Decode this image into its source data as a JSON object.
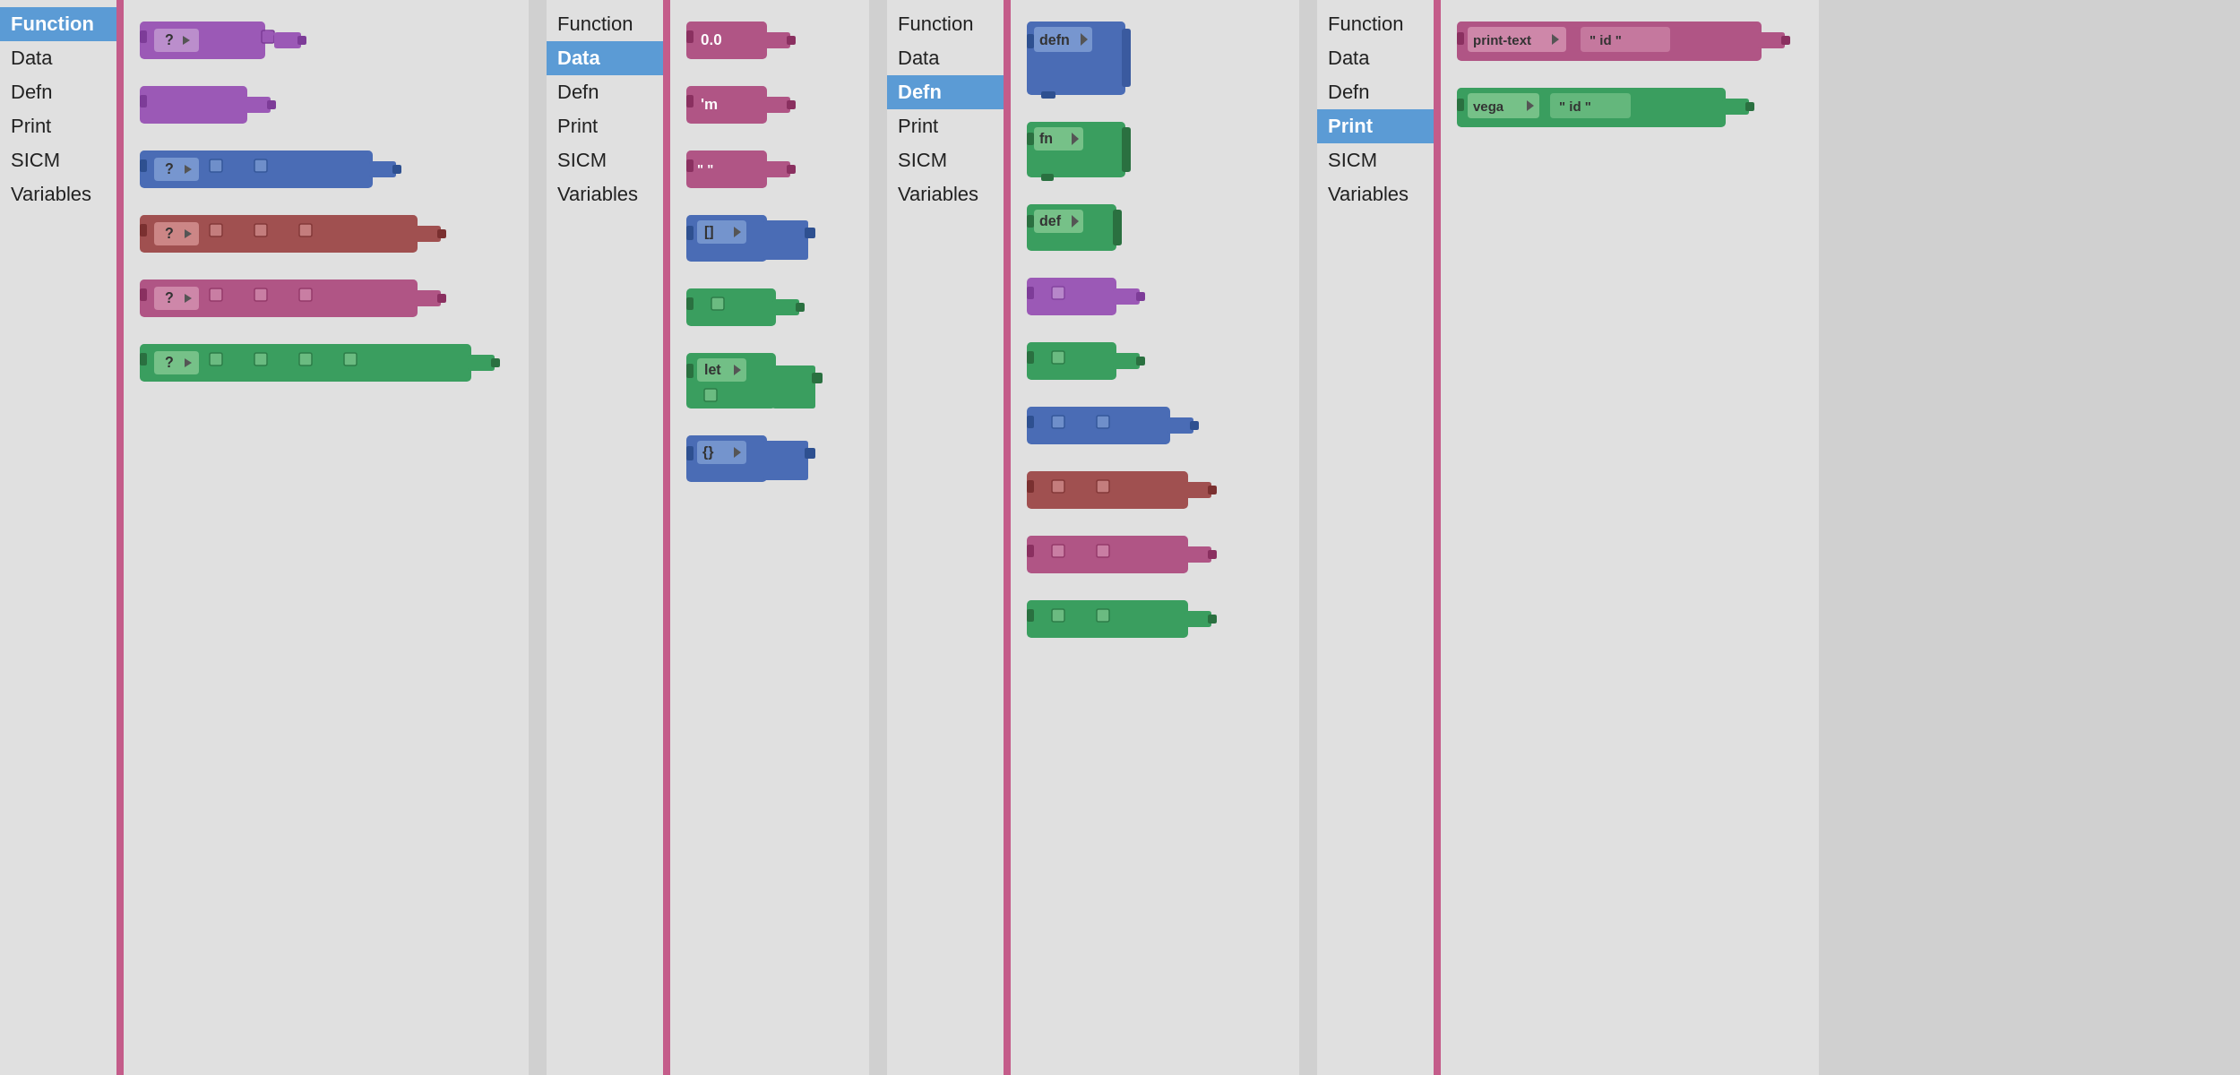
{
  "panels": [
    {
      "id": "panel1",
      "sidebar": {
        "items": [
          {
            "label": "Function",
            "active": true
          },
          {
            "label": "Data",
            "active": false
          },
          {
            "label": "Defn",
            "active": false
          },
          {
            "label": "Print",
            "active": false
          },
          {
            "label": "SICM",
            "active": false
          },
          {
            "label": "Variables",
            "active": false
          }
        ]
      },
      "blocks": [
        {
          "type": "single-connector",
          "color": "purple",
          "hasQuestion": true,
          "connectors": 1
        },
        {
          "type": "single-connector",
          "color": "purple",
          "hasQuestion": false,
          "connectors": 1
        },
        {
          "type": "multi-connector",
          "color": "blue",
          "hasQuestion": true,
          "connectors": 2
        },
        {
          "type": "multi-connector",
          "color": "red",
          "hasQuestion": true,
          "connectors": 3
        },
        {
          "type": "multi-connector",
          "color": "pink",
          "hasQuestion": true,
          "connectors": 3
        },
        {
          "type": "multi-connector",
          "color": "green",
          "hasQuestion": true,
          "connectors": 4
        }
      ]
    },
    {
      "id": "panel2",
      "sidebar": {
        "items": [
          {
            "label": "Function",
            "active": false
          },
          {
            "label": "Data",
            "active": true
          },
          {
            "label": "Defn",
            "active": false
          },
          {
            "label": "Print",
            "active": false
          },
          {
            "label": "SICM",
            "active": false
          },
          {
            "label": "Variables",
            "active": false
          }
        ]
      },
      "blocks": [
        {
          "type": "value",
          "color": "pink",
          "label": "0.0"
        },
        {
          "type": "value",
          "color": "pink",
          "label": "'m"
        },
        {
          "type": "value",
          "color": "pink",
          "label": "\" \""
        },
        {
          "type": "list",
          "color": "blue",
          "label": "[]"
        },
        {
          "type": "connector-block",
          "color": "green"
        },
        {
          "type": "let",
          "color": "green",
          "label": "let"
        },
        {
          "type": "map",
          "color": "blue",
          "label": "{}"
        }
      ]
    },
    {
      "id": "panel3",
      "sidebar": {
        "items": [
          {
            "label": "Function",
            "active": false
          },
          {
            "label": "Data",
            "active": false
          },
          {
            "label": "Defn",
            "active": true
          },
          {
            "label": "Print",
            "active": false
          },
          {
            "label": "SICM",
            "active": false
          },
          {
            "label": "Variables",
            "active": false
          }
        ]
      },
      "blocks": [
        {
          "type": "defn",
          "label": "defn"
        },
        {
          "type": "fn",
          "label": "fn"
        },
        {
          "type": "def",
          "label": "def"
        },
        {
          "type": "purple-single"
        },
        {
          "type": "green-single"
        },
        {
          "type": "blue-double"
        },
        {
          "type": "red-double"
        },
        {
          "type": "pink-double"
        },
        {
          "type": "green-double"
        }
      ]
    },
    {
      "id": "panel4",
      "sidebar": {
        "items": [
          {
            "label": "Function",
            "active": false
          },
          {
            "label": "Data",
            "active": false
          },
          {
            "label": "Defn",
            "active": false
          },
          {
            "label": "Print",
            "active": true
          },
          {
            "label": "SICM",
            "active": false
          },
          {
            "label": "Variables",
            "active": false
          }
        ]
      },
      "blocks": [
        {
          "type": "print-text",
          "label1": "print-text",
          "label2": "\" id \""
        },
        {
          "type": "vega",
          "label1": "vega",
          "label2": "\" id \""
        }
      ]
    }
  ]
}
